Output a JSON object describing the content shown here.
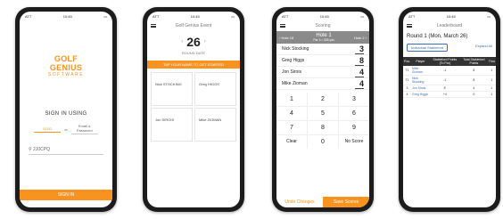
{
  "status": {
    "carrier": "ATT",
    "time": "10:45"
  },
  "p1": {
    "logo_title": "GOLF GENIUS",
    "logo_sub": "SOFTWARE",
    "sign_in": "SIGN IN USING",
    "mode_a": "GGID",
    "or": "or",
    "mode_b": "Email & Password",
    "field": "2J0CPQ",
    "button": "SIGN IN"
  },
  "p2": {
    "nav_title": "Golf Genius Event",
    "round": "26",
    "round_label": "ROUND DATE",
    "tap": "TAP YOUR NAME TO GET STARTED",
    "players": [
      "Nick STOCKING",
      "Greg HIGGS",
      "Jon SIROIS",
      "Mike ZIOMAN"
    ]
  },
  "p3": {
    "nav_title": "Scoring",
    "hole": "Hole 1",
    "hole_sub": "Par 4 • 335 yds",
    "prev": "‹ Hole 18",
    "next": "Hole 2 ›",
    "rows": [
      {
        "name": "Nick Stocking",
        "score": "3"
      },
      {
        "name": "Greg Higgs",
        "score": "8"
      },
      {
        "name": "Jon Sirois",
        "score": "4"
      },
      {
        "name": "Mike Zioman",
        "score": "4"
      }
    ],
    "keys": [
      "1",
      "2",
      "3",
      "4",
      "5",
      "6",
      "7",
      "8",
      "9",
      "Clear",
      "0",
      "No Score"
    ],
    "undo": "Undo Changes",
    "save": "Save Scores"
  },
  "p4": {
    "nav_title": "Leaderboard",
    "round": "Round 1 (Mon, March 26)",
    "individual": "Individual Stableford",
    "expand": "Expand All",
    "headers": [
      "Pos.",
      "Player",
      "Stableford Points (To Par)",
      "Total Stableford Points",
      "Thru"
    ],
    "rows": [
      [
        "T1",
        "Mike Zioman",
        "-1",
        "8",
        "1"
      ],
      [
        "T1",
        "Nick Stocking",
        "-1",
        "8",
        "1"
      ],
      [
        "3",
        "Jon Sirois",
        "E",
        "4",
        "1"
      ],
      [
        "4",
        "Greg Higgs",
        "+4",
        "0",
        "1"
      ]
    ]
  },
  "colors": {
    "accent": "#f7931e",
    "link": "#3b6fb6"
  }
}
